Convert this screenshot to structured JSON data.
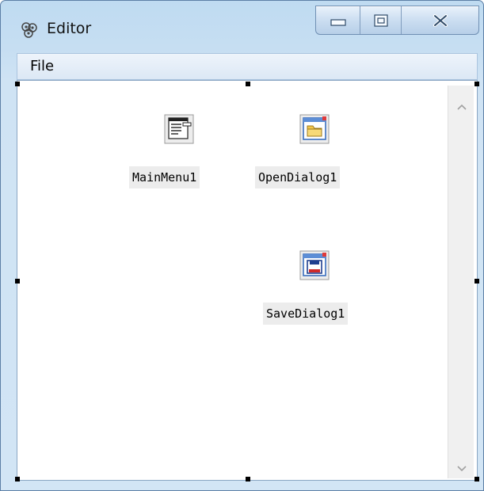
{
  "window": {
    "title": "Editor"
  },
  "caption": {
    "minimize_icon": "minimize-icon",
    "maximize_icon": "maximize-icon",
    "close_icon": "close-icon"
  },
  "menu": {
    "items": [
      {
        "label": "File"
      }
    ]
  },
  "components": [
    {
      "label": "MainMenu1",
      "icon": "main-menu-icon"
    },
    {
      "label": "OpenDialog1",
      "icon": "open-dialog-icon"
    },
    {
      "label": "SaveDialog1",
      "icon": "save-dialog-icon"
    }
  ],
  "colors": {
    "titlebar": "#c6def2",
    "selection_handle": "#000000",
    "label_bg": "#ececec"
  }
}
